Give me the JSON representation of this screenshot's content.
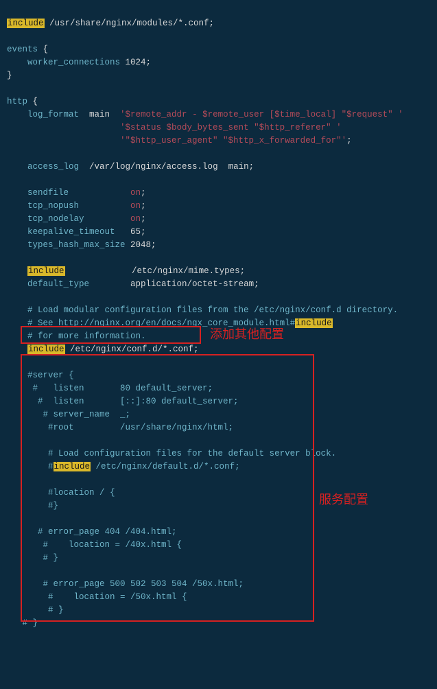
{
  "lines": {
    "l1_include": "include",
    "l1_path": " /usr/share/nginx/modules/*.conf;",
    "l2_events": "events",
    "l2_brace": " {",
    "l3_wc": "    worker_connections",
    "l3_val": " 1024;",
    "l4_brace": "}",
    "l5_http": "http",
    "l5_brace": " {",
    "l6_lf": "    log_format",
    "l6_main": "  main  ",
    "l6_str": "'$remote_addr - $remote_user [$time_local] \"$request\" '",
    "l7_pad": "                      ",
    "l7_str": "'$status $body_bytes_sent \"$http_referer\" '",
    "l8_pad": "                      ",
    "l8_str": "'\"$http_user_agent\" \"$http_x_forwarded_for\"'",
    "l8_semi": ";",
    "l9_al": "    access_log",
    "l9_rest": "  /var/log/nginx/access.log  main;",
    "l10_sf": "    sendfile",
    "l10_pad": "            ",
    "l10_on": "on",
    "l10_semi": ";",
    "l11_tn": "    tcp_nopush",
    "l11_pad": "          ",
    "l11_on": "on",
    "l11_semi": ";",
    "l12_td": "    tcp_nodelay",
    "l12_pad": "         ",
    "l12_on": "on",
    "l12_semi": ";",
    "l13_kt": "    keepalive_timeout",
    "l13_val": "   65;",
    "l14_th": "    types_hash_max_size",
    "l14_val": " 2048;",
    "l15_pad": "    ",
    "l15_include": "include",
    "l15_rest": "             /etc/nginx/mime.types;",
    "l16_dt": "    default_type",
    "l16_rest": "        application/octet-stream;",
    "l17": "    # Load modular configuration files from the /etc/nginx/conf.d directory.",
    "l18a": "    # See http://nginx.org/en/docs/ngx_core_module.html#",
    "l18_hl": "include",
    "l19": "    # for more information.",
    "l20_pad": "    ",
    "l20_include": "include",
    "l20_rest": " /etc/nginx/conf.d/*.conf;",
    "l21": "    #server {",
    "l22": "     #   listen       80 default_server;",
    "l23": "      #  listen       [::]:80 default_server;",
    "l24": "       # server_name  _;",
    "l25": "        #root         /usr/share/nginx/html;",
    "l26": "        # Load configuration files for the default server block.",
    "l27a": "        #",
    "l27_hl": "include",
    "l27b": " /etc/nginx/default.d/*.conf;",
    "l28": "        #location / {",
    "l29": "        #}",
    "l30": "      # error_page 404 /404.html;",
    "l31": "       #    location = /40x.html {",
    "l32": "       # }",
    "l33": "       # error_page 500 502 503 504 /50x.html;",
    "l34": "        #    location = /50x.html {",
    "l35": "        # }",
    "l36": "   # }"
  },
  "annotations": {
    "a1": "添加其他配置",
    "a2": "服务配置"
  }
}
